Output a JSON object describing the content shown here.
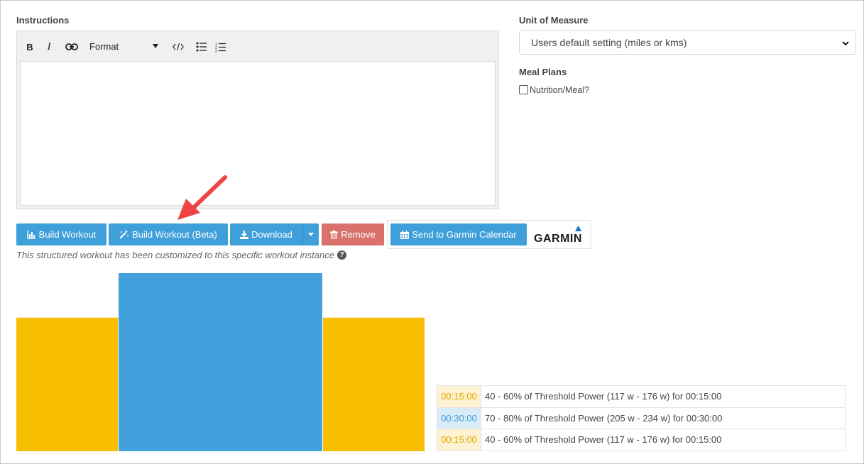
{
  "instructions": {
    "label": "Instructions",
    "toolbar": {
      "bold": "B",
      "italic": "I",
      "format_label": "Format"
    },
    "content": ""
  },
  "unit_of_measure": {
    "label": "Unit of Measure",
    "selected": "Users default setting (miles or kms)"
  },
  "meal_plans": {
    "label": "Meal Plans",
    "checkbox_label": "Nutrition/Meal?",
    "checked": false
  },
  "buttons": {
    "build_workout": "Build Workout",
    "build_workout_beta": "Build Workout (Beta)",
    "download": "Download",
    "remove": "Remove",
    "send_to_garmin": "Send to Garmin Calendar",
    "garmin_logo": "GARMIN"
  },
  "note": "This structured workout has been customized to this specific workout instance",
  "colors": {
    "warmup": "#f7bf00",
    "main": "#42a1dc",
    "button_blue": "#3e9fd9",
    "button_red": "#d9726d",
    "arrow": "#ef4444"
  },
  "chart_data": {
    "type": "bar",
    "categories": [
      "00:15:00",
      "00:30:00",
      "00:15:00"
    ],
    "durations_min": [
      15,
      30,
      15
    ],
    "values": [
      0.6,
      0.8,
      0.6
    ],
    "colors": [
      "#f7bf00",
      "#42a1dc",
      "#f7bf00"
    ],
    "title": "",
    "xlabel": "",
    "ylabel": ""
  },
  "steps": [
    {
      "time": "00:15:00",
      "description": "40 - 60% of Threshold Power (117 w - 176 w) for 00:15:00",
      "zone": "amber"
    },
    {
      "time": "00:30:00",
      "description": "70 - 80% of Threshold Power (205 w - 234 w) for 00:30:00",
      "zone": "blue"
    },
    {
      "time": "00:15:00",
      "description": "40 - 60% of Threshold Power (117 w - 176 w) for 00:15:00",
      "zone": "amber"
    }
  ]
}
